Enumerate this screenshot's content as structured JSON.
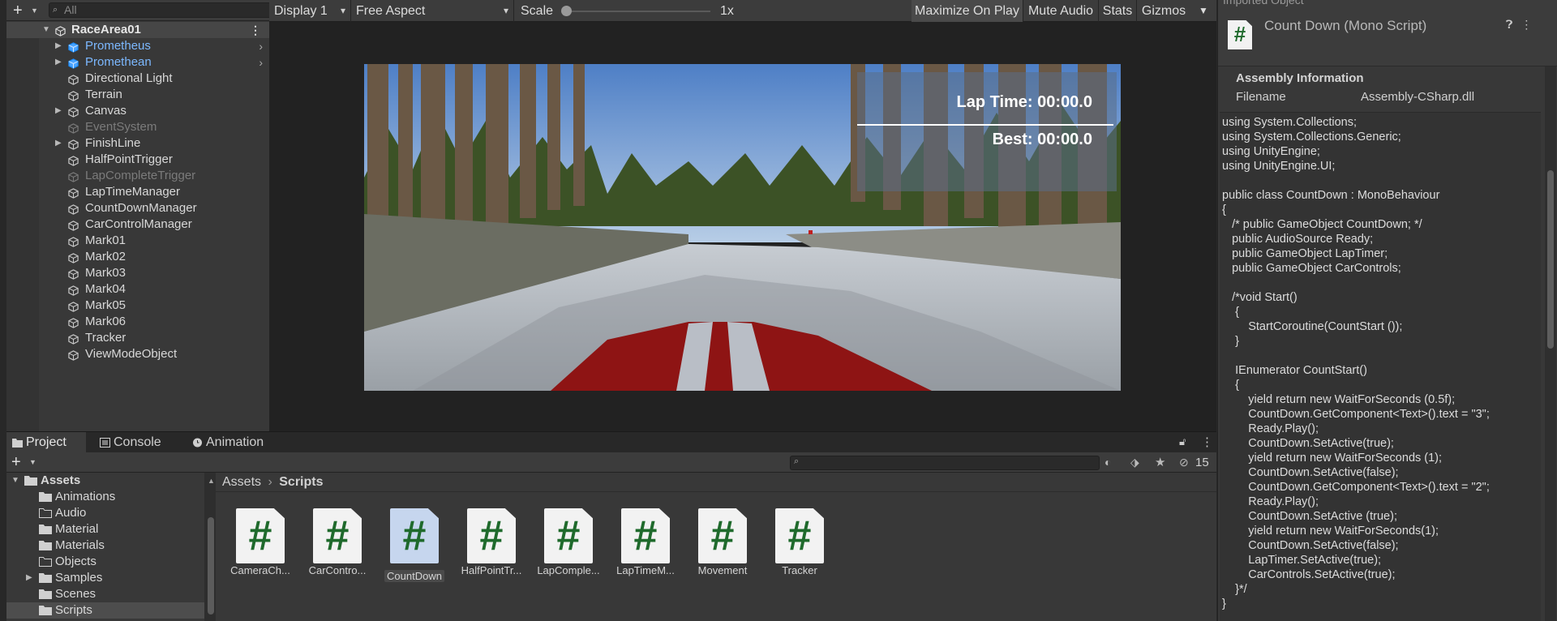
{
  "hierarchy": {
    "search_placeholder": "All",
    "root": "RaceArea01",
    "items": [
      {
        "label": "Prometheus",
        "kind": "prefab"
      },
      {
        "label": "Promethean",
        "kind": "prefab"
      },
      {
        "label": "Directional Light",
        "kind": "normal"
      },
      {
        "label": "Terrain",
        "kind": "normal"
      },
      {
        "label": "Canvas",
        "kind": "normal"
      },
      {
        "label": "EventSystem",
        "kind": "disabled"
      },
      {
        "label": "FinishLine",
        "kind": "normal"
      },
      {
        "label": "HalfPointTrigger",
        "kind": "normal"
      },
      {
        "label": "LapCompleteTrigger",
        "kind": "disabled"
      },
      {
        "label": "LapTimeManager",
        "kind": "normal"
      },
      {
        "label": "CountDownManager",
        "kind": "normal"
      },
      {
        "label": "CarControlManager",
        "kind": "normal"
      },
      {
        "label": "Mark01",
        "kind": "normal"
      },
      {
        "label": "Mark02",
        "kind": "normal"
      },
      {
        "label": "Mark03",
        "kind": "normal"
      },
      {
        "label": "Mark04",
        "kind": "normal"
      },
      {
        "label": "Mark05",
        "kind": "normal"
      },
      {
        "label": "Mark06",
        "kind": "normal"
      },
      {
        "label": "Tracker",
        "kind": "normal"
      },
      {
        "label": "ViewModeObject",
        "kind": "normal"
      }
    ]
  },
  "game_toolbar": {
    "display": "Display 1",
    "aspect": "Free Aspect",
    "scale_label": "Scale",
    "scale_value": "1x",
    "maximize": "Maximize On Play",
    "mute": "Mute Audio",
    "stats": "Stats",
    "gizmos": "Gizmos"
  },
  "hud": {
    "lap_label": "Lap Time:",
    "lap_value": "00:00.0",
    "best_label": "Best:",
    "best_value": "00:00.0"
  },
  "project": {
    "tabs": [
      "Project",
      "Console",
      "Animation"
    ],
    "hidden_count": "15",
    "tree": [
      {
        "label": "Assets",
        "level": 0,
        "expanded": true
      },
      {
        "label": "Animations",
        "level": 1,
        "empty": false
      },
      {
        "label": "Audio",
        "level": 1,
        "empty": true
      },
      {
        "label": "Material",
        "level": 1,
        "empty": false
      },
      {
        "label": "Materials",
        "level": 1,
        "empty": false
      },
      {
        "label": "Objects",
        "level": 1,
        "empty": true
      },
      {
        "label": "Samples",
        "level": 1,
        "empty": false,
        "collapsed": true
      },
      {
        "label": "Scenes",
        "level": 1,
        "empty": false
      },
      {
        "label": "Scripts",
        "level": 1,
        "empty": false,
        "selected": true
      }
    ],
    "breadcrumb": [
      "Assets",
      "Scripts"
    ],
    "assets": [
      "CameraCh...",
      "CarContro...",
      "CountDown",
      "HalfPointTr...",
      "LapComple...",
      "LapTimeM...",
      "Movement",
      "Tracker"
    ],
    "selected_asset": "CountDown"
  },
  "inspector": {
    "top_label": "Imported Object",
    "title": "Count Down (Mono Script)",
    "section": "Assembly Information",
    "filename_label": "Filename",
    "filename_value": "Assembly-CSharp.dll",
    "code": "using System.Collections;\nusing System.Collections.Generic;\nusing UnityEngine;\nusing UnityEngine.UI;\n\npublic class CountDown : MonoBehaviour\n{\n   /* public GameObject CountDown; */\n   public AudioSource Ready;\n   public GameObject LapTimer;\n   public GameObject CarControls;\n\n   /*void Start()\n    {\n        StartCoroutine(CountStart ());\n    }\n\n    IEnumerator CountStart()\n    {\n        yield return new WaitForSeconds (0.5f);\n        CountDown.GetComponent<Text>().text = \"3\";\n        Ready.Play();\n        CountDown.SetActive(true);\n        yield return new WaitForSeconds (1);\n        CountDown.SetActive(false);\n        CountDown.GetComponent<Text>().text = \"2\";\n        Ready.Play();\n        CountDown.SetActive (true);\n        yield return new WaitForSeconds(1);\n        CountDown.SetActive(false);\n        LapTimer.SetActive(true);\n        CarControls.SetActive(true);\n    }*/\n}"
  },
  "colors": {
    "prefab_text": "#7cb8ff",
    "script_hash": "#1f6a2c",
    "car_red": "#8e1414"
  }
}
